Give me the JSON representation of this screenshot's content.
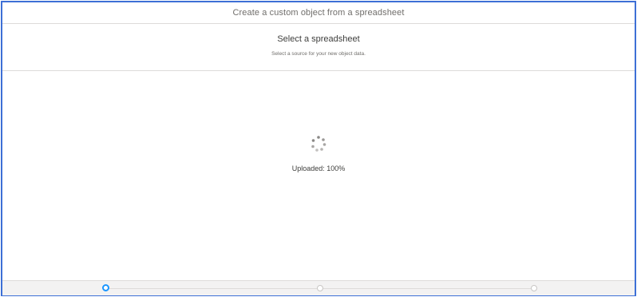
{
  "modal": {
    "title": "Create a custom object from a spreadsheet"
  },
  "step": {
    "title": "Select a spreadsheet",
    "subtitle": "Select a source for your new object data."
  },
  "status": {
    "spinner_icon": "loading-spinner-icon",
    "text": "Uploaded: 100%"
  },
  "progress": {
    "steps": [
      "step-1",
      "step-2",
      "step-3"
    ],
    "current_step": 1,
    "accent_color": "#1b96ff"
  }
}
